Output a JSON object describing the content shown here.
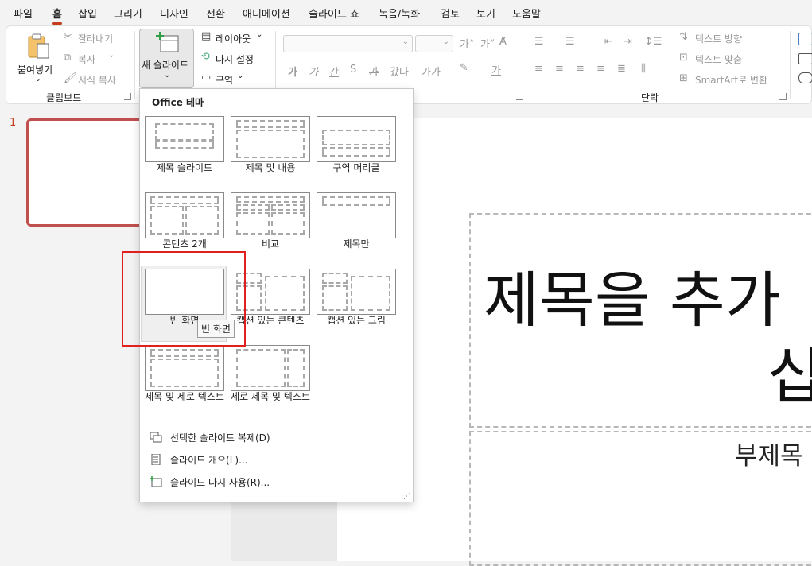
{
  "menu": {
    "tabs": [
      "파일",
      "홈",
      "삽입",
      "그리기",
      "디자인",
      "전환",
      "애니메이션",
      "슬라이드 쇼",
      "녹음/녹화",
      "검토",
      "보기",
      "도움말"
    ],
    "active": "홈"
  },
  "ribbon": {
    "clipboard": {
      "paste": "붙여넣기",
      "cut": "잘라내기",
      "copy": "복사",
      "format_painter": "서식 복사",
      "group_label": "클립보드"
    },
    "slides": {
      "new_slide": "새 슬라이드",
      "layout": "레이아웃",
      "reset": "다시 설정",
      "section": "구역"
    },
    "font": {
      "font_name": "",
      "font_size": ""
    },
    "paragraph": {
      "text_direction": "텍스트 방향",
      "align_text": "텍스트 맞춤",
      "smartart": "SmartArt로 변환",
      "group_label": "단락"
    }
  },
  "slide_panel": {
    "number": "1"
  },
  "slide": {
    "title_line1": "제목을 추가",
    "title_line2": "십",
    "subtitle": "부제목"
  },
  "gallery": {
    "title": "Office 테마",
    "layouts": [
      {
        "label": "제목 슬라이드"
      },
      {
        "label": "제목 및 내용"
      },
      {
        "label": "구역 머리글"
      },
      {
        "label": "콘텐츠 2개"
      },
      {
        "label": "비교"
      },
      {
        "label": "제목만"
      },
      {
        "label": "빈 화면"
      },
      {
        "label": "캡션 있는 콘텐츠"
      },
      {
        "label": "캡션 있는 그림"
      },
      {
        "label": "제목 및 세로 텍스트"
      },
      {
        "label": "세로 제목 및 텍스트"
      }
    ],
    "hovered_tooltip": "빈 화면",
    "commands": [
      "선택한 슬라이드 복제(D)",
      "슬라이드 개요(L)...",
      "슬라이드 다시 사용(R)..."
    ]
  },
  "colors": {
    "accent": "#c43e1c",
    "highlight_box": "#e0201e",
    "thumb_border": "#c0504d"
  }
}
